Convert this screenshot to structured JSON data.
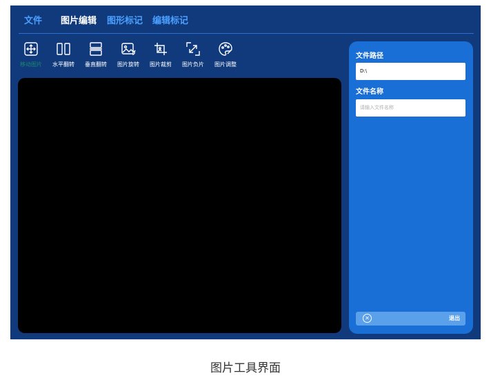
{
  "menu": {
    "items": [
      {
        "label": "文件",
        "color": "#4aa0ff"
      },
      {
        "label": "图片编辑",
        "color": "#ffffff"
      },
      {
        "label": "图形标记",
        "color": "#4aa0ff"
      },
      {
        "label": "编辑标记",
        "color": "#4aa0ff"
      }
    ]
  },
  "toolbar": {
    "tools": [
      {
        "label": "移动图片",
        "icon": "move-icon",
        "active": true
      },
      {
        "label": "水平翻转",
        "icon": "flip-horizontal-icon"
      },
      {
        "label": "垂直翻转",
        "icon": "flip-vertical-icon"
      },
      {
        "label": "图片旋转",
        "icon": "rotate-image-icon"
      },
      {
        "label": "图片裁剪",
        "icon": "crop-image-icon"
      },
      {
        "label": "图片负片",
        "icon": "negative-image-icon"
      },
      {
        "label": "图片调整",
        "icon": "palette-icon"
      }
    ]
  },
  "panel": {
    "path_label": "文件路径",
    "path_value": "D:\\",
    "name_label": "文件名称",
    "name_placeholder": "请输入文件名称",
    "exit_label": "退出",
    "exit_icon": "close-circle-icon"
  },
  "caption": "图片工具界面",
  "colors": {
    "window_bg": "#113a7d",
    "panel_bg": "#1a6fd6",
    "accent": "#4aa0ff",
    "canvas_bg": "#000000"
  }
}
